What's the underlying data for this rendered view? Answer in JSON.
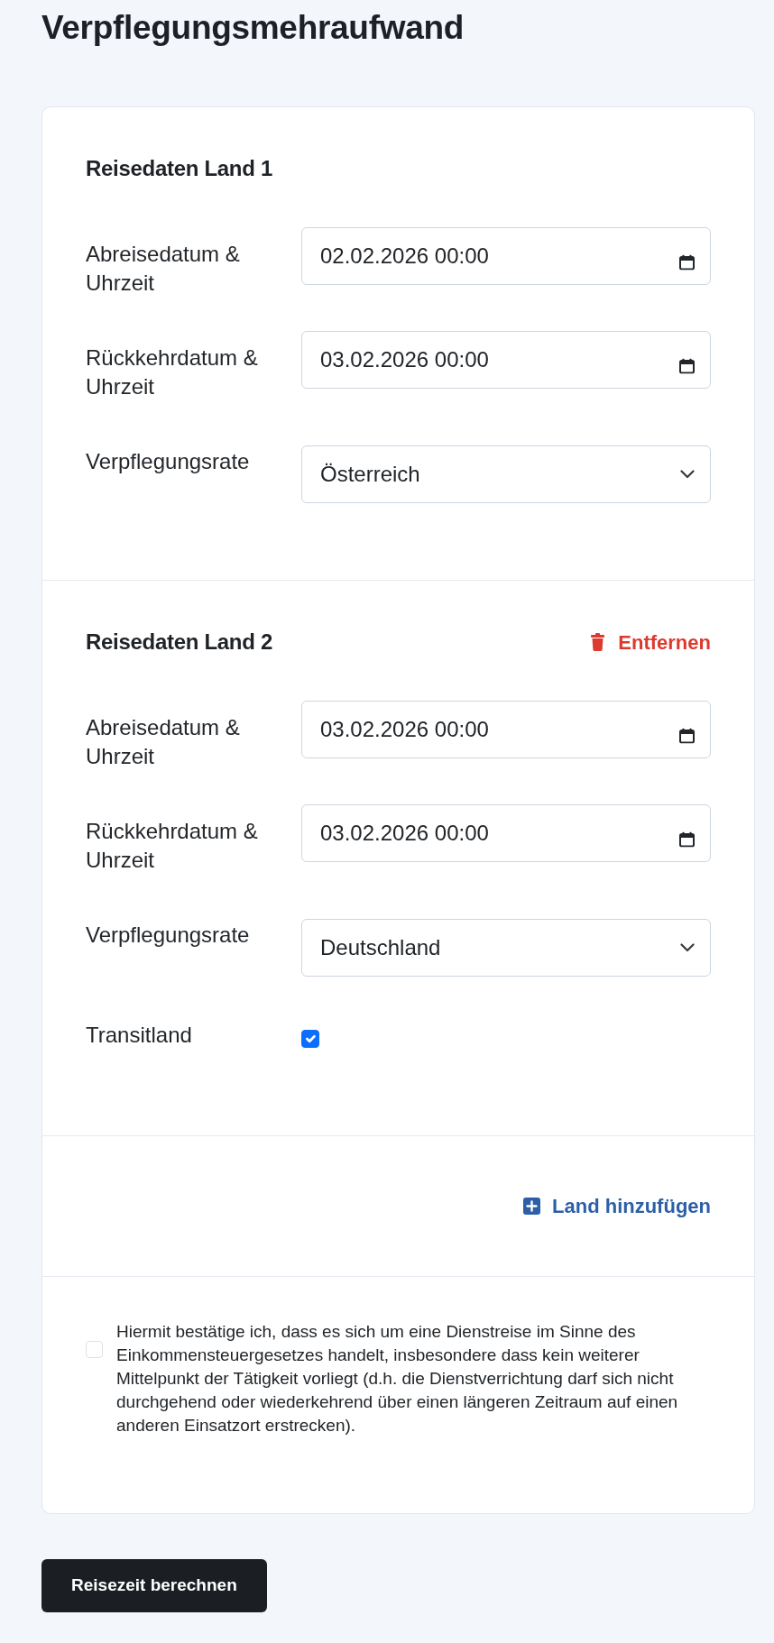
{
  "page": {
    "title": "Verpflegungsmehraufwand"
  },
  "countries": [
    {
      "heading": "Reisedaten Land 1",
      "fields": [
        {
          "kind": "datetime",
          "label": "Abreisedatum & Uhrzeit",
          "value": "02.02.2026 00:00"
        },
        {
          "kind": "datetime",
          "label": "Rückkehrdatum & Uhrzeit",
          "value": "03.02.2026 00:00"
        },
        {
          "kind": "select",
          "label": "Verpflegungsrate",
          "value": "Österreich"
        }
      ]
    },
    {
      "heading": "Reisedaten Land 2",
      "remove_button": {
        "label": "Entfernen"
      },
      "fields": [
        {
          "kind": "datetime",
          "label": "Abreisedatum & Uhrzeit",
          "value": "03.02.2026 00:00"
        },
        {
          "kind": "datetime",
          "label": "Rückkehrdatum & Uhrzeit",
          "value": "03.02.2026 00:00"
        },
        {
          "kind": "select",
          "label": "Verpflegungsrate",
          "value": "Deutschland"
        },
        {
          "kind": "checkbox",
          "label": "Transitland",
          "checked": true
        }
      ]
    }
  ],
  "add_button": {
    "label": "Land hinzufügen"
  },
  "confirmation": {
    "text": "Hiermit bestätige ich, dass es sich um eine Dienstreise im Sinne des Einkommensteuergesetzes handelt, insbesondere dass kein weiterer Mittelpunkt der Tätigkeit vorliegt (d.h. die Dienstverrichtung darf sich nicht durchgehend oder wiederkehrend über einen längeren Zeitraum auf einen anderen Einsatzort erstrecken).",
    "checked": false
  },
  "submit_button": {
    "label": "Reisezeit berechnen"
  }
}
